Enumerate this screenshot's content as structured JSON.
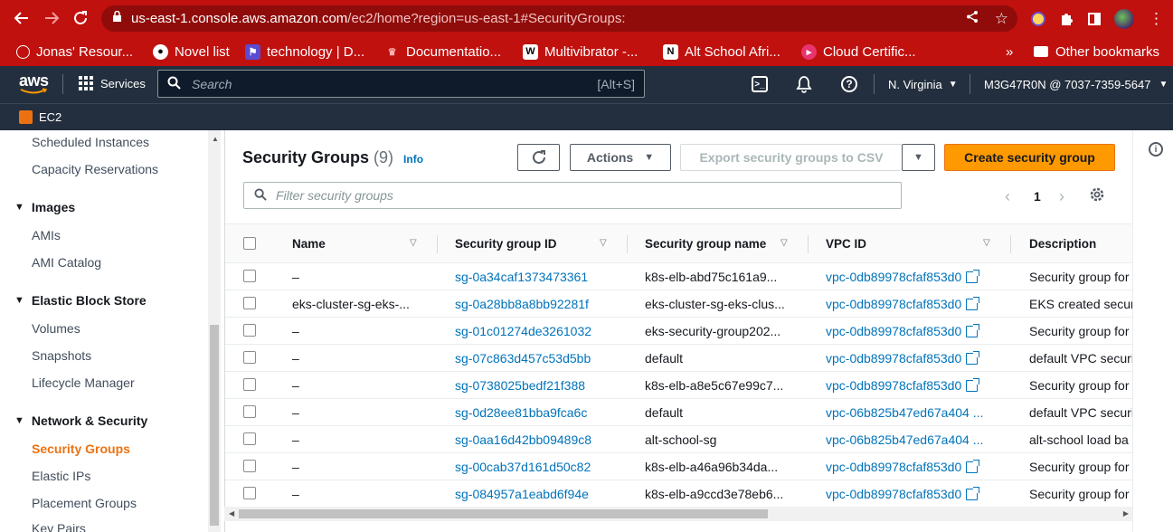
{
  "browser": {
    "url_host": "us-east-1.console.aws.amazon.com",
    "url_path": "/ec2/home?region=us-east-1#SecurityGroups:",
    "bookmarks": [
      {
        "label": "Jonas' Resour..."
      },
      {
        "label": "Novel list"
      },
      {
        "label": "technology | D..."
      },
      {
        "label": "Documentatio..."
      },
      {
        "label": "Multivibrator -..."
      },
      {
        "label": "Alt School Afri..."
      },
      {
        "label": "Cloud Certific..."
      }
    ],
    "more_label": "»",
    "other_bookmarks": "Other bookmarks"
  },
  "aws": {
    "logo": "aws",
    "services_label": "Services",
    "search_placeholder": "Search",
    "search_shortcut": "[Alt+S]",
    "region": "N. Virginia",
    "account": "M3G47R0N @ 7037-7359-5647",
    "breadcrumb_service": "EC2"
  },
  "sidebar": {
    "items_top": [
      "Scheduled Instances",
      "Capacity Reservations"
    ],
    "images_heading": "Images",
    "images_items": [
      "AMIs",
      "AMI Catalog"
    ],
    "ebs_heading": "Elastic Block Store",
    "ebs_items": [
      "Volumes",
      "Snapshots",
      "Lifecycle Manager"
    ],
    "netsec_heading": "Network & Security",
    "netsec_items": [
      "Security Groups",
      "Elastic IPs",
      "Placement Groups",
      "Key Pairs"
    ]
  },
  "main": {
    "title": "Security Groups",
    "count": "(9)",
    "info_label": "Info",
    "actions_label": "Actions",
    "export_label": "Export security groups to CSV",
    "create_label": "Create security group",
    "filter_placeholder": "Filter security groups",
    "page_number": "1",
    "columns": [
      "Name",
      "Security group ID",
      "Security group name",
      "VPC ID",
      "Description"
    ],
    "rows": [
      {
        "name": "–",
        "id": "sg-0a34caf1373473361",
        "sgname": "k8s-elb-abd75c161a9...",
        "vpc": "vpc-0db89978cfaf853d0",
        "desc": "Security group for"
      },
      {
        "name": "eks-cluster-sg-eks-...",
        "id": "sg-0a28bb8a8bb92281f",
        "sgname": "eks-cluster-sg-eks-clus...",
        "vpc": "vpc-0db89978cfaf853d0",
        "desc": "EKS created securi"
      },
      {
        "name": "–",
        "id": "sg-01c01274de3261032",
        "sgname": "eks-security-group202...",
        "vpc": "vpc-0db89978cfaf853d0",
        "desc": "Security group for"
      },
      {
        "name": "–",
        "id": "sg-07c863d457c53d5bb",
        "sgname": "default",
        "vpc": "vpc-0db89978cfaf853d0",
        "desc": "default VPC securi"
      },
      {
        "name": "–",
        "id": "sg-0738025bedf21f388",
        "sgname": "k8s-elb-a8e5c67e99c7...",
        "vpc": "vpc-0db89978cfaf853d0",
        "desc": "Security group for"
      },
      {
        "name": "–",
        "id": "sg-0d28ee81bba9fca6c",
        "sgname": "default",
        "vpc": "vpc-06b825b47ed67a404 ...",
        "desc": "default VPC securi"
      },
      {
        "name": "–",
        "id": "sg-0aa16d42bb09489c8",
        "sgname": "alt-school-sg",
        "vpc": "vpc-06b825b47ed67a404 ...",
        "desc": "alt-school load ba"
      },
      {
        "name": "–",
        "id": "sg-00cab37d161d50c82",
        "sgname": "k8s-elb-a46a96b34da...",
        "vpc": "vpc-0db89978cfaf853d0",
        "desc": "Security group for"
      },
      {
        "name": "–",
        "id": "sg-084957a1eabd6f94e",
        "sgname": "k8s-elb-a9ccd3e78eb6...",
        "vpc": "vpc-0db89978cfaf853d0",
        "desc": "Security group for"
      }
    ]
  },
  "colors": {
    "browser": "#c0110f",
    "aws_nav": "#232f3e",
    "accent": "#ec7211",
    "link": "#0073bb",
    "primary_button": "#ff9900"
  }
}
